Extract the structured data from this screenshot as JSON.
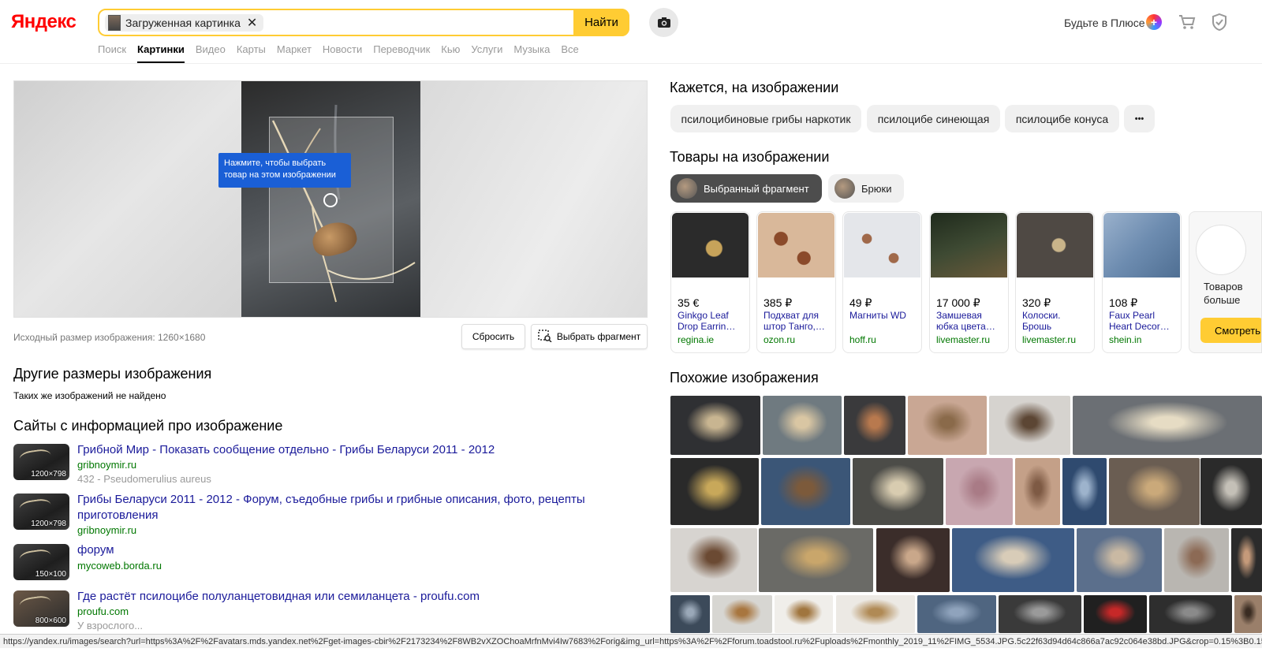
{
  "header": {
    "logo": "Яндекс",
    "search_chip": "Загруженная картинка",
    "search_button": "Найти",
    "plus_label": "Будьте в Плюсе",
    "tabs": [
      "Поиск",
      "Картинки",
      "Видео",
      "Карты",
      "Маркет",
      "Новости",
      "Переводчик",
      "Кью",
      "Услуги",
      "Музыка",
      "Все"
    ],
    "active_tab": "Картинки"
  },
  "image_panel": {
    "tooltip": "Нажмите, чтобы выбрать товар на этом изображении",
    "original_size": "Исходный размер изображения: 1260×1680",
    "reset_button": "Сбросить",
    "select_fragment_button": "Выбрать фрагмент"
  },
  "other_sizes": {
    "title": "Другие размеры изображения",
    "note": "Таких же изображений не найдено"
  },
  "sites": {
    "title": "Сайты с информацией про изображение",
    "items": [
      {
        "title": "Грибной Мир - Показать сообщение отдельно - Грибы Беларуси 2011 - 2012",
        "domain": "gribnoymir.ru",
        "desc": "432 - Pseudomerulius aureus",
        "size": "1200×798"
      },
      {
        "title": "Грибы Беларуси 2011 - 2012 - Форум, съедобные грибы и грибные описания, фото, рецепты приготовления",
        "domain": "gribnoymir.ru",
        "desc": "",
        "size": "1200×798"
      },
      {
        "title": "форум",
        "domain": "mycoweb.borda.ru",
        "desc": "",
        "size": "150×100"
      },
      {
        "title": "Где растёт псилоцибе полуланцетовидная или семиланцета - proufu.com",
        "domain": "proufu.com",
        "desc": "У взрослого...",
        "size": "800×600"
      }
    ]
  },
  "seems": {
    "title": "Кажется, на изображении",
    "tags": [
      "псилоцибиновые грибы наркотик",
      "псилоцибе синеющая",
      "псилоцибе конуса"
    ],
    "more": "•••"
  },
  "goods": {
    "title": "Товары на изображении",
    "tabs": [
      "Выбранный фрагмент",
      "Брюки"
    ],
    "cards": [
      {
        "price": "35 €",
        "name": "Ginkgo Leaf Drop Earrin…",
        "shop": "regina.ie",
        "color": "#2b2b2b"
      },
      {
        "price": "385 ₽",
        "name": "Подхват для штор Танго,…",
        "shop": "ozon.ru",
        "color": "#d9b89a"
      },
      {
        "price": "49 ₽",
        "name": "Магниты WD",
        "shop": "hoff.ru",
        "color": "#e4e6ea"
      },
      {
        "price": "17 000 ₽",
        "name": "Замшевая юбка цвета…",
        "shop": "livemaster.ru",
        "color": "#3e4a33"
      },
      {
        "price": "320 ₽",
        "name": "Колоски. Брошь",
        "shop": "livemaster.ru",
        "color": "#5a5048"
      },
      {
        "price": "108 ₽",
        "name": "Faux Pearl Heart Decor…",
        "shop": "shein.in",
        "color": "#6d8cb0"
      }
    ],
    "more_text": "Товаров больше",
    "more_button": "Смотреть"
  },
  "similar": {
    "title": "Похожие изображения"
  },
  "status_url": "https://yandex.ru/images/search?url=https%3A%2F%2Favatars.mds.yandex.net%2Fget-images-cbir%2F2173234%2F8WB2vXZOChoaMrfnMvi4Iw7683%2Forig&img_url=https%3A%2F%2Fforum.toadstool.ru%2Fuploads%2Fmonthly_2019_11%2FIMG_5534.JPG.5c22f63d94d64c866a7ac92c064e38bd.JPG&crop=0.15%3B0.15%3B0.85%3B0.85"
}
